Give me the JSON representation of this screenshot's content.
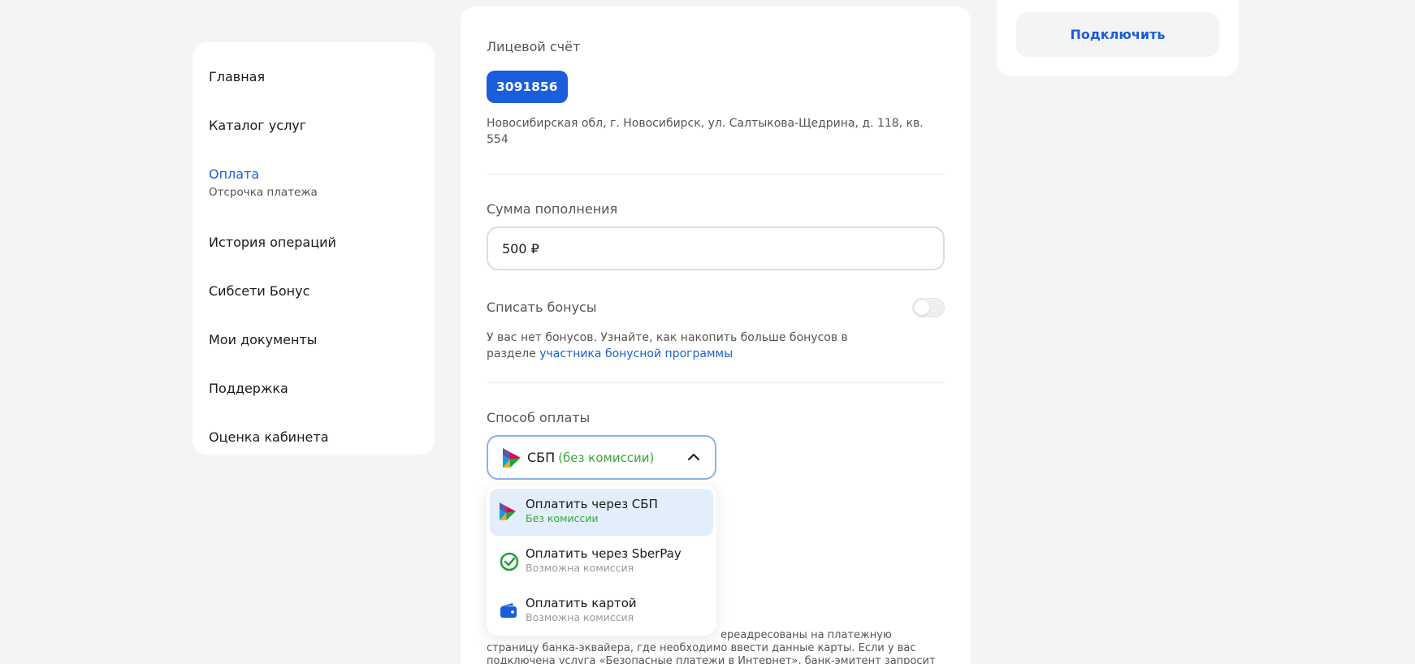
{
  "sidebar": {
    "items": [
      {
        "label": "Главная"
      },
      {
        "label": "Каталог услуг"
      },
      {
        "label": "Оплата",
        "sub": "Отсрочка платежа"
      },
      {
        "label": "История операций"
      },
      {
        "label": "Сибсети Бонус"
      },
      {
        "label": "Мои документы"
      },
      {
        "label": "Поддержка"
      },
      {
        "label": "Оценка кабинета"
      }
    ]
  },
  "account": {
    "label": "Лицевой счёт",
    "number": "3091856",
    "address": "Новосибирская обл, г. Новосибирск, ул. Салтыкова-Щедрина, д. 118, кв. 554"
  },
  "amount": {
    "label": "Сумма пополнения",
    "value": "500 ₽"
  },
  "bonus": {
    "label": "Списать бонусы",
    "enabled": false,
    "text": "У вас нет бонусов. Узнайте, как накопить больше бонусов в разделе ",
    "link": "участника бонусной программы"
  },
  "payment": {
    "label": "Способ оплаты",
    "selected_name": "СБП",
    "selected_note": "(без комиссии)",
    "options": [
      {
        "title": "Оплатить через СБП",
        "sub": "Без комиссии",
        "icon": "sbp-icon"
      },
      {
        "title": "Оплатить через SberPay",
        "sub": "Возможна комиссия",
        "icon": "sberpay-icon"
      },
      {
        "title": "Оплатить картой",
        "sub": "Возможна комиссия",
        "icon": "card-wallet-icon"
      }
    ]
  },
  "info": {
    "text": "ереадресованы на платежную страницу банка-эквайера, где необходимо ввести данные карты. Если у вас подключена услуга «Безопасные платежи в Интернет», банк-эмитент запросит пароль"
  },
  "right_card": {
    "connect_label": "Подключить"
  },
  "colors": {
    "accent": "#1a5edb",
    "success": "#3aa635",
    "background": "#f4f4f4"
  }
}
